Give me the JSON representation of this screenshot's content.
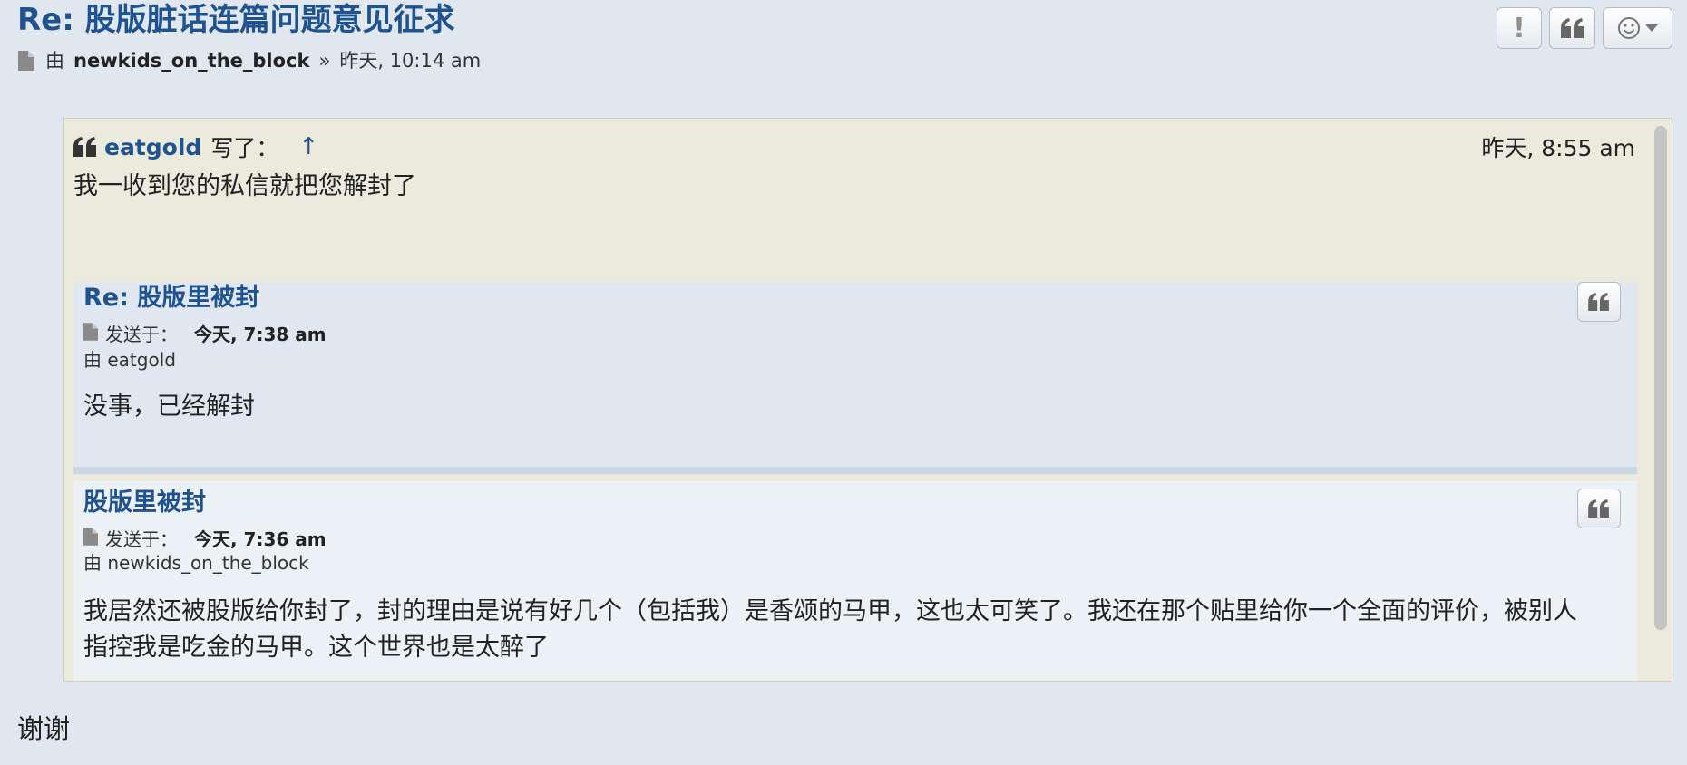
{
  "post": {
    "title": "Re: 股版脏话连篇问题意见征求",
    "by_label": "由",
    "author": "newkids_on_the_block",
    "separator": "»",
    "time": "昨天, 10:14 am"
  },
  "buttons": {
    "report_glyph": "!"
  },
  "quote": {
    "author": "eatgold",
    "wrote_label": "写了：",
    "up_arrow": "↑",
    "time": "昨天, 8:55 am",
    "text": "我一收到您的私信就把您解封了",
    "messages": [
      {
        "title": "Re: 股版里被封",
        "sent_label": "发送于：",
        "sent_time": "今天, 7:38 am",
        "by_line": "由 eatgold",
        "body": "没事，已经解封"
      },
      {
        "title": "股版里被封",
        "sent_label": "发送于：",
        "sent_time": "今天, 7:36 am",
        "by_line": "由 newkids_on_the_block",
        "body": "我居然还被股版给你封了，封的理由是说有好几个（包括我）是香颂的马甲，这也太可笑了。我还在那个贴里给你一个全面的评价，被别人指控我是吃金的马甲。这个世界也是太醉了"
      }
    ]
  },
  "post_body_text": "谢谢",
  "colors": {
    "link_blue": "#1f5390",
    "page_bg": "#e1e7ef",
    "quote_bg": "#ebeadd"
  }
}
